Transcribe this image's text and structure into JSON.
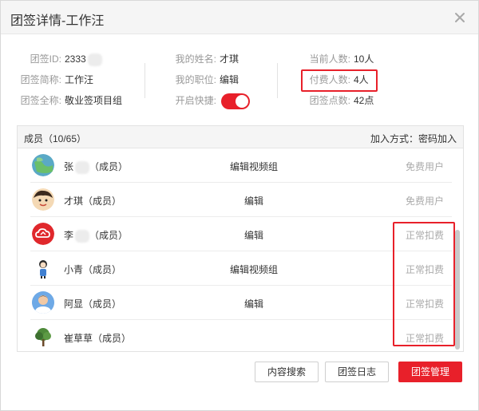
{
  "dialog": {
    "title": "团签详情-工作汪"
  },
  "info": {
    "col1": [
      {
        "label": "团签ID:",
        "value": "2333"
      },
      {
        "label": "团签简称:",
        "value": "工作汪"
      },
      {
        "label": "团签全称:",
        "value": "敬业签项目组"
      }
    ],
    "col2": [
      {
        "label": "我的姓名:",
        "value": "才琪"
      },
      {
        "label": "我的职位:",
        "value": "编辑"
      },
      {
        "label": "开启快捷:",
        "value": ""
      }
    ],
    "col3": [
      {
        "label": "当前人数:",
        "value": "10人"
      },
      {
        "label": "付费人数:",
        "value": "4人"
      },
      {
        "label": "团签点数:",
        "value": "42点"
      }
    ],
    "shortcut_enabled": true
  },
  "members": {
    "header_left": "成员（10/65）",
    "header_right": "加入方式：密码加入",
    "rows": [
      {
        "name_prefix": "张",
        "name_suffix": "（成员）",
        "masked": true,
        "role": "编辑视频组",
        "status": "免费用户",
        "avatar": "globe"
      },
      {
        "name_prefix": "才琪（成员）",
        "name_suffix": "",
        "masked": false,
        "role": "编辑",
        "status": "免费用户",
        "avatar": "cartoon"
      },
      {
        "name_prefix": "李",
        "name_suffix": "（成员）",
        "masked": true,
        "role": "编辑",
        "status": "正常扣费",
        "avatar": "red-cloud"
      },
      {
        "name_prefix": "小青（成员）",
        "name_suffix": "",
        "masked": false,
        "role": "编辑视频组",
        "status": "正常扣费",
        "avatar": "girl"
      },
      {
        "name_prefix": "阿显（成员）",
        "name_suffix": "",
        "masked": false,
        "role": "编辑",
        "status": "正常扣费",
        "avatar": "person"
      },
      {
        "name_prefix": "崔草草（成员）",
        "name_suffix": "",
        "masked": false,
        "role": "",
        "status": "正常扣费",
        "avatar": "tree"
      }
    ]
  },
  "footer": {
    "search_label": "内容搜索",
    "log_label": "团签日志",
    "manage_label": "团签管理"
  },
  "colors": {
    "accent": "#e8202a",
    "muted": "#999999"
  }
}
